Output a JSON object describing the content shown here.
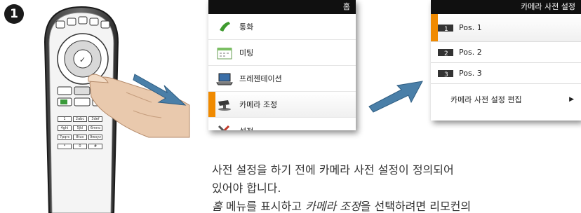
{
  "step": {
    "number": "1"
  },
  "home_menu": {
    "title": "홈",
    "items": [
      {
        "label": "통화",
        "icon": "phone-handset-icon"
      },
      {
        "label": "미팅",
        "icon": "calendar-icon"
      },
      {
        "label": "프레젠테이션",
        "icon": "laptop-icon"
      },
      {
        "label": "카메라 조정",
        "icon": "camera-icon",
        "selected": true
      },
      {
        "label": "설정",
        "icon": "tools-icon"
      }
    ]
  },
  "preset_menu": {
    "title": "카메라 사전 설정",
    "items": [
      {
        "label": "Pos. 1",
        "icon": "preset-1-icon",
        "selected": true
      },
      {
        "label": "Pos. 2",
        "icon": "preset-2-icon"
      },
      {
        "label": "Pos. 3",
        "icon": "preset-3-icon"
      },
      {
        "label": "카메라 사전 설정 편집",
        "icon": "chevron-right-icon"
      }
    ]
  },
  "caption": {
    "line1": "사전 설정을 하기 전에 카메라 사전 설정이 정의되어",
    "line2": "있어야 합니다.",
    "line3_a": "홈",
    "line3_b": " 메뉴를 표시하고 ",
    "line3_c": "카메라 조정",
    "line3_d": "을 선택하려면 리모컨의"
  },
  "remote": {
    "keys": [
      "1",
      "2abc",
      "3def",
      "4ghi",
      "5jkl",
      "6mno",
      "7pqrs",
      "8tuv",
      "9wxyz",
      "*",
      "0",
      "#"
    ]
  },
  "colors": {
    "accent": "#f08a00",
    "title_bar": "#101010",
    "arrow": "#4a7fa8"
  }
}
